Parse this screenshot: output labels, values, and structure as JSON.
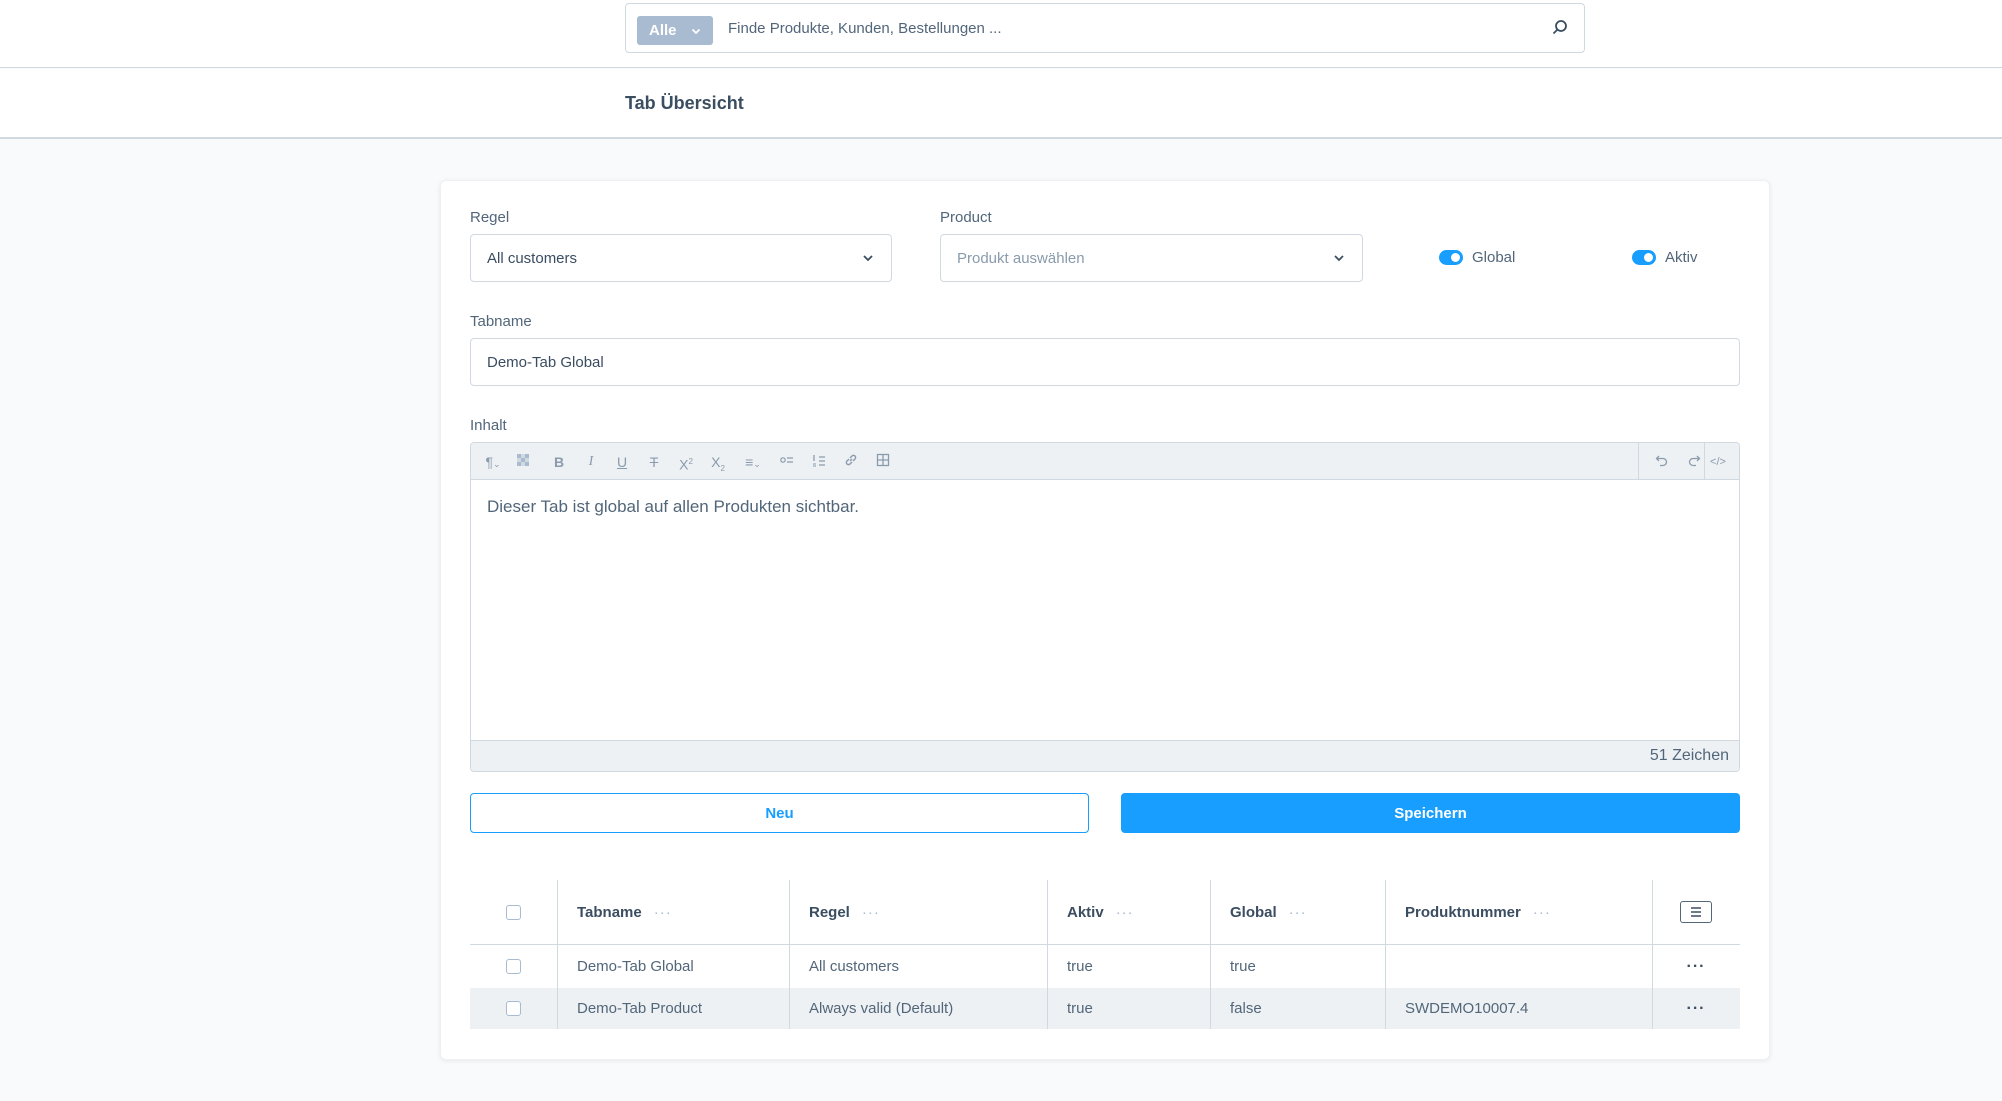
{
  "search": {
    "type_label": "Alle",
    "placeholder": "Finde Produkte, Kunden, Bestellungen ..."
  },
  "header": {
    "title": "Tab Übersicht"
  },
  "form": {
    "rule": {
      "label": "Regel",
      "value": "All customers"
    },
    "product": {
      "label": "Product",
      "placeholder": "Produkt auswählen"
    },
    "global": {
      "label": "Global",
      "enabled": true
    },
    "active": {
      "label": "Aktiv",
      "enabled": true
    },
    "tabname": {
      "label": "Tabname",
      "value": "Demo-Tab Global"
    },
    "content": {
      "label": "Inhalt",
      "text": "Dieser Tab ist global auf allen Produkten sichtbar.",
      "char_count": "51 Zeichen",
      "toolbar": [
        "paragraph-format-icon",
        "clear-format-icon",
        "bold-icon",
        "italic-icon",
        "underline-icon",
        "strikethrough-icon",
        "superscript-icon",
        "subscript-icon",
        "align-icon",
        "unordered-list-icon",
        "ordered-list-icon",
        "link-icon",
        "table-icon",
        "undo-icon",
        "redo-icon",
        "code-view-icon"
      ]
    },
    "buttons": {
      "new": "Neu",
      "save": "Speichern"
    }
  },
  "table": {
    "columns": [
      "Tabname",
      "Regel",
      "Aktiv",
      "Global",
      "Produktnummer"
    ],
    "column_dots": "···",
    "row_action": "···",
    "rows": [
      {
        "tabname": "Demo-Tab Global",
        "rule": "All customers",
        "active": "true",
        "global": "true",
        "product_number": ""
      },
      {
        "tabname": "Demo-Tab Product",
        "rule": "Always valid (Default)",
        "active": "true",
        "global": "false",
        "product_number": "SWDEMO10007.4"
      }
    ]
  },
  "colors": {
    "primary": "#189eff",
    "text": "#52667a",
    "border": "#d1d9e0"
  }
}
